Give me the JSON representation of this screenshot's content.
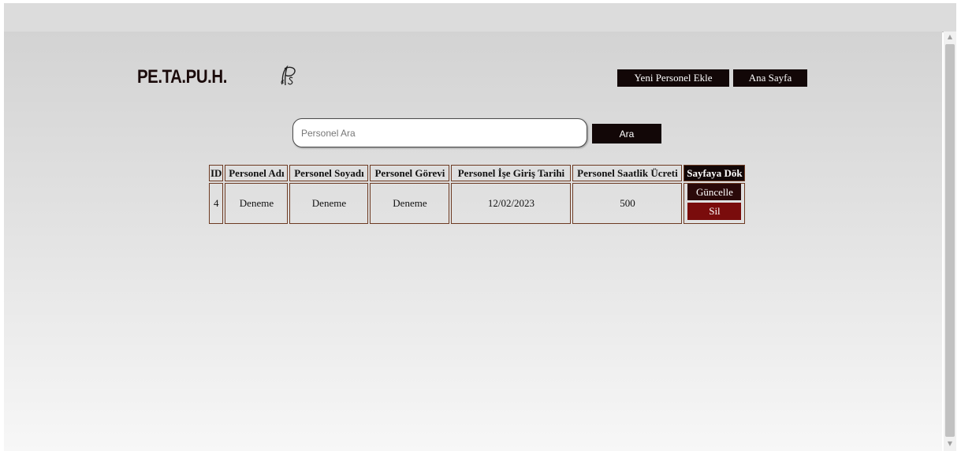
{
  "header": {
    "logo_text": "PE.TA.PU.H.",
    "logo_mark_icon": "ps-monogram-icon",
    "nav": {
      "new_personnel_label": "Yeni Personel Ekle",
      "home_label": "Ana Sayfa"
    }
  },
  "search": {
    "placeholder": "Personel Ara",
    "value": "",
    "button_label": "Ara"
  },
  "table": {
    "columns": [
      "ID",
      "Personel Adı",
      "Personel Soyadı",
      "Personel Görevi",
      "Personel İşe Giriş Tarihi",
      "Personel Saatlik Ücreti",
      "Sayfaya Dök"
    ],
    "rows": [
      {
        "id": "4",
        "name": "Deneme",
        "surname": "Deneme",
        "role": "Deneme",
        "start_date": "12/02/2023",
        "hourly_wage": "500",
        "update_label": "Güncelle",
        "delete_label": "Sil"
      }
    ]
  },
  "colors": {
    "button_dark": "#120707",
    "delete_red": "#7a0c0c",
    "table_border": "#6d3a22"
  }
}
